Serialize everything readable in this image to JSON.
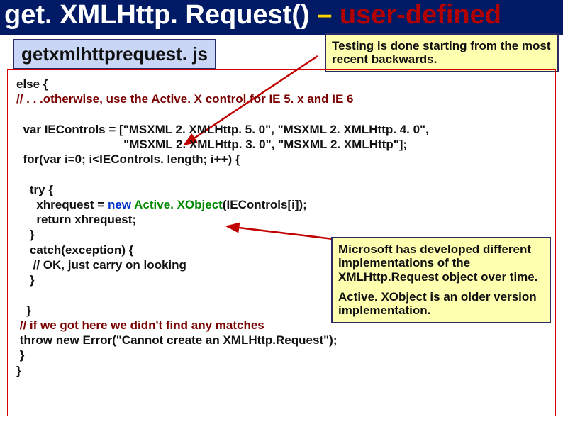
{
  "title": {
    "part1": "get. XMLHttp. Request()",
    "separator": " – ",
    "part2": "user-defined"
  },
  "tab_label": "getxmlhttprequest. js",
  "callout_top": "Testing is done starting from the most recent backwards.",
  "callout_mid_p1": "Microsoft has developed different implementations of the XMLHttp.Request object over time.",
  "callout_mid_p2": "Active. XObject is an older version implementation.",
  "code": {
    "l1a": "else { ",
    "l2_comment": "// . . .otherwise, use the Active. X control for IE 5. x and IE 6",
    "l4a": "  var IEControls = [\"MSXML 2. XMLHttp. 5. 0\", \"MSXML 2. XMLHttp. 4. 0\",",
    "l5a": "                                \"MSXML 2. XMLHttp. 3. 0\", \"MSXML 2. XMLHttp\"];",
    "l6a": "  for(var i=0; i<IEControls. length; i++) {",
    "l8a": "    try {",
    "l9a": "      xhrequest = ",
    "l9_new": "new ",
    "l9_obj": "Active. XObject",
    "l9b": "(IEControls[i]);",
    "l10a": "      return xhrequest;",
    "l11a": "    }",
    "l12a": "    catch(exception) {",
    "l13a": "     // OK, just carry on looking",
    "l14a": "    }",
    "l16a": "   }",
    "l17_comment": " // if we got here we didn't find any matches",
    "l18a": " throw new Error(\"Cannot create an XMLHttp.Request\");",
    "l19a": " }",
    "l20a": "}"
  }
}
